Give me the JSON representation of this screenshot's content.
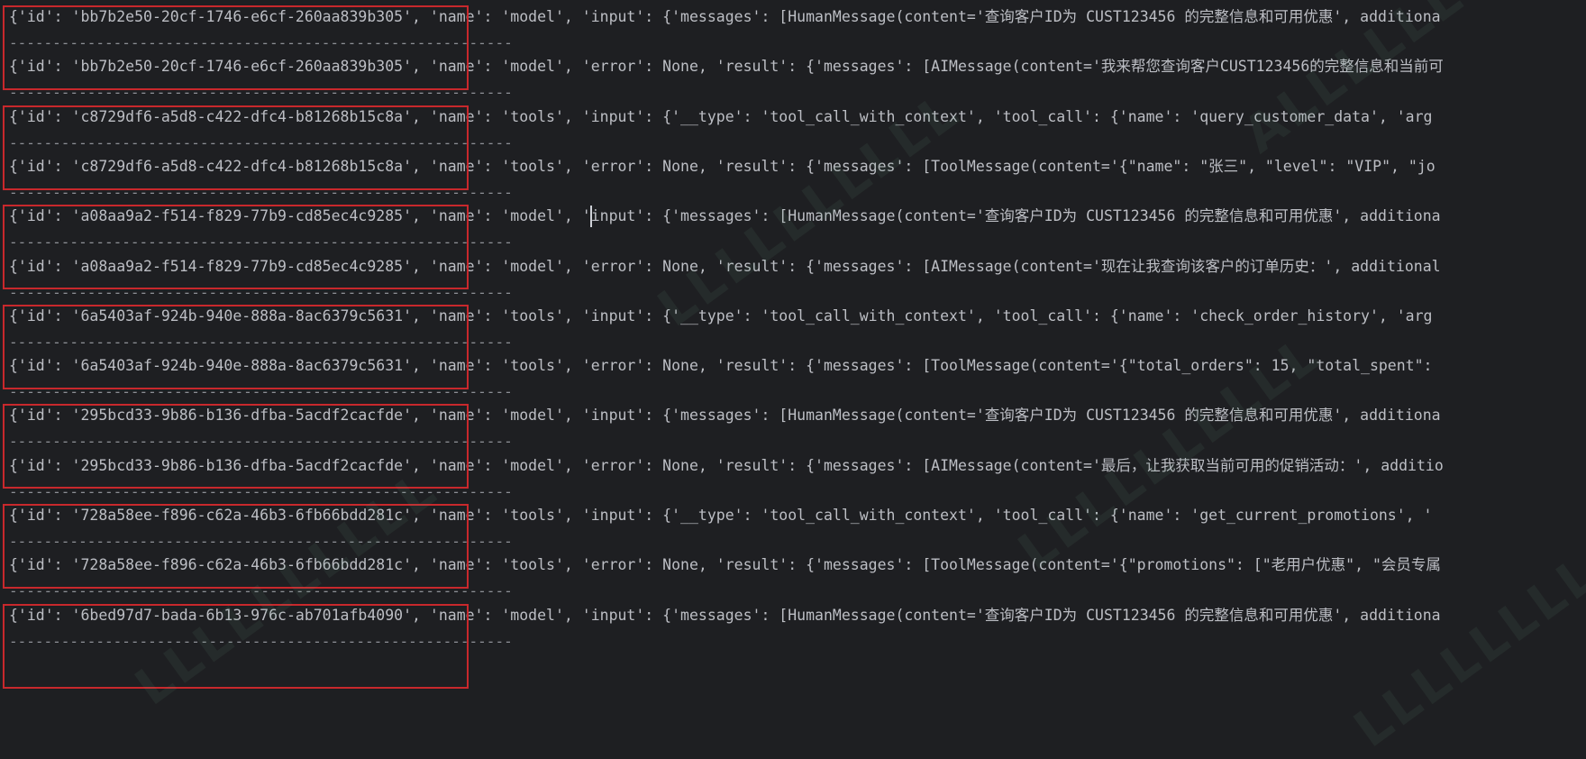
{
  "separator": "------------------------------------------------------------",
  "lines": [
    "{'id': 'bb7b2e50-20cf-1746-e6cf-260aa839b305', 'name': 'model', 'input': {'messages': [HumanMessage(content='查询客户ID为 CUST123456 的完整信息和可用优惠', additiona",
    "{'id': 'bb7b2e50-20cf-1746-e6cf-260aa839b305', 'name': 'model', 'error': None, 'result': {'messages': [AIMessage(content='我来帮您查询客户CUST123456的完整信息和当前可",
    "{'id': 'c8729df6-a5d8-c422-dfc4-b81268b15c8a', 'name': 'tools', 'input': {'__type': 'tool_call_with_context', 'tool_call': {'name': 'query_customer_data', 'arg",
    "{'id': 'c8729df6-a5d8-c422-dfc4-b81268b15c8a', 'name': 'tools', 'error': None, 'result': {'messages': [ToolMessage(content='{\"name\": \"张三\", \"level\": \"VIP\", \"jo",
    "{'id': 'a08aa9a2-f514-f829-77b9-cd85ec4c9285', 'name': 'model', 'input': {'messages': [HumanMessage(content='查询客户ID为 CUST123456 的完整信息和可用优惠', additiona",
    "{'id': 'a08aa9a2-f514-f829-77b9-cd85ec4c9285', 'name': 'model', 'error': None, 'result': {'messages': [AIMessage(content='现在让我查询该客户的订单历史：', additional",
    "{'id': '6a5403af-924b-940e-888a-8ac6379c5631', 'name': 'tools', 'input': {'__type': 'tool_call_with_context', 'tool_call': {'name': 'check_order_history', 'arg",
    "{'id': '6a5403af-924b-940e-888a-8ac6379c5631', 'name': 'tools', 'error': None, 'result': {'messages': [ToolMessage(content='{\"total_orders\": 15, \"total_spent\":",
    "{'id': '295bcd33-9b86-b136-dfba-5acdf2cacfde', 'name': 'model', 'input': {'messages': [HumanMessage(content='查询客户ID为 CUST123456 的完整信息和可用优惠', additiona",
    "{'id': '295bcd33-9b86-b136-dfba-5acdf2cacfde', 'name': 'model', 'error': None, 'result': {'messages': [AIMessage(content='最后，让我获取当前可用的促销活动：', additio",
    "{'id': '728a58ee-f896-c62a-46b3-6fb66bdd281c', 'name': 'tools', 'input': {'__type': 'tool_call_with_context', 'tool_call': {'name': 'get_current_promotions', '",
    "{'id': '728a58ee-f896-c62a-46b3-6fb66bdd281c', 'name': 'tools', 'error': None, 'result': {'messages': [ToolMessage(content='{\"promotions\": [\"老用户优惠\", \"会员专属",
    "{'id': '6bed97d7-bada-6b13-976c-ab701afb4090', 'name': 'model', 'input': {'messages': [HumanMessage(content='查询客户ID为 CUST123456 的完整信息和可用优惠', additiona"
  ],
  "colors": {
    "background": "#1e1f22",
    "text": "#bcbec4",
    "separator": "#8c8f95",
    "highlight_box": "#c8282c"
  }
}
